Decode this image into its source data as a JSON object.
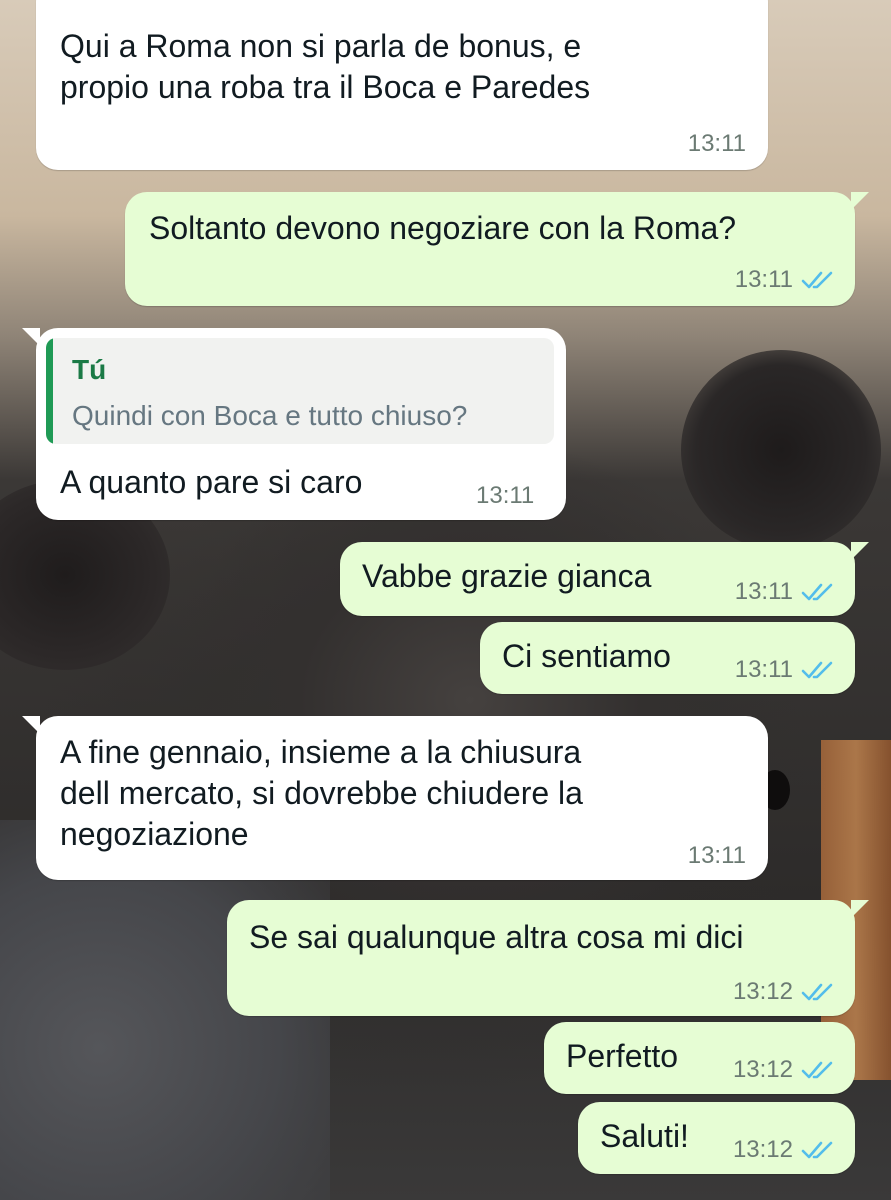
{
  "messages": [
    {
      "direction": "incoming",
      "lines": [
        "Qui a Roma non si parla de bonus, e",
        "propio una roba tra il Boca e Paredes"
      ],
      "time": "13:11"
    },
    {
      "direction": "outgoing",
      "lines": [
        "Soltanto devono negoziare con la Roma?"
      ],
      "time": "13:11",
      "status": "read"
    },
    {
      "direction": "incoming",
      "reply_to": {
        "author": "Tú",
        "text": "Quindi con Boca e tutto chiuso?"
      },
      "lines": [
        "A quanto pare si caro"
      ],
      "time": "13:11"
    },
    {
      "direction": "outgoing",
      "lines": [
        "Vabbe grazie gianca"
      ],
      "time": "13:11",
      "status": "read"
    },
    {
      "direction": "outgoing",
      "lines": [
        "Ci sentiamo"
      ],
      "time": "13:11",
      "status": "read"
    },
    {
      "direction": "incoming",
      "lines": [
        "A fine gennaio, insieme a la chiusura",
        "dell mercato, si dovrebbe chiudere la",
        "negoziazione"
      ],
      "time": "13:11"
    },
    {
      "direction": "outgoing",
      "lines": [
        "Se sai qualunque altra cosa mi dici"
      ],
      "time": "13:12",
      "status": "read"
    },
    {
      "direction": "outgoing",
      "lines": [
        "Perfetto"
      ],
      "time": "13:12",
      "status": "read"
    },
    {
      "direction": "outgoing",
      "lines": [
        "Saluti!"
      ],
      "time": "13:12",
      "status": "read"
    }
  ],
  "colors": {
    "incoming_bubble": "#ffffff",
    "outgoing_bubble": "#e6fdd4",
    "read_ticks": "#53bdeb",
    "quote_accent": "#1f9a55"
  },
  "icons": {
    "read_receipt": "double-check-icon"
  }
}
